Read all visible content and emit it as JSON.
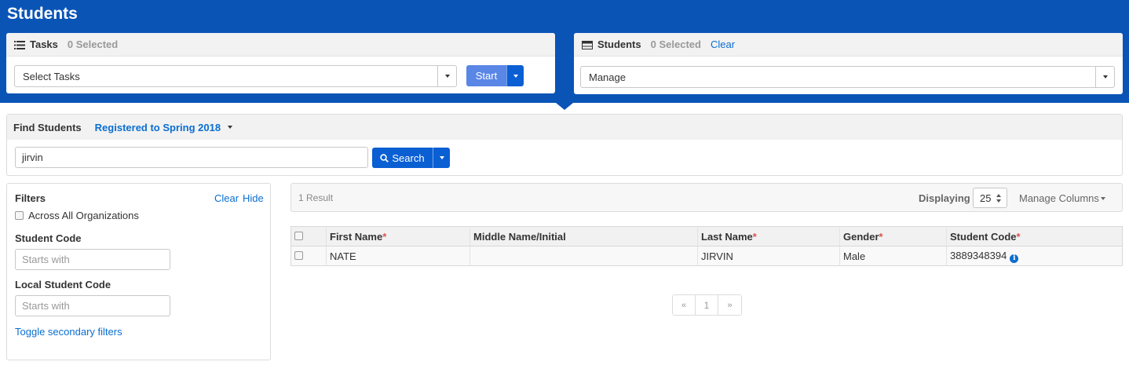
{
  "header": {
    "title": "Students"
  },
  "tasks": {
    "title": "Tasks",
    "selected_count": "0 Selected",
    "select_placeholder": "Select Tasks",
    "start_label": "Start"
  },
  "students_panel": {
    "title": "Students",
    "selected_count": "0 Selected",
    "clear_label": "Clear",
    "manage_value": "Manage"
  },
  "find": {
    "title": "Find Students",
    "filter_link": "Registered to Spring 2018",
    "search_value": "jirvin",
    "search_label": "Search"
  },
  "filters": {
    "title": "Filters",
    "clear_label": "Clear",
    "hide_label": "Hide",
    "across_orgs_label": "Across All Organizations",
    "student_code_label": "Student Code",
    "student_code_placeholder": "Starts with",
    "local_code_label": "Local Student Code",
    "local_code_placeholder": "Starts with",
    "toggle_secondary": "Toggle secondary filters"
  },
  "results": {
    "count_text": "1 Result",
    "displaying_label": "Displaying",
    "per_page": "25",
    "manage_columns": "Manage Columns"
  },
  "table": {
    "columns": [
      {
        "label": "First Name",
        "required": "*"
      },
      {
        "label": "Middle Name/Initial",
        "required": ""
      },
      {
        "label": "Last Name",
        "required": "*"
      },
      {
        "label": "Gender",
        "required": "*"
      },
      {
        "label": "Student Code",
        "required": "*"
      }
    ],
    "rows": [
      {
        "first": "NATE",
        "middle": "",
        "last": "JIRVIN",
        "gender": "Male",
        "code": "3889348394"
      }
    ]
  },
  "pagination": {
    "prev": "«",
    "page": "1",
    "next": "»"
  },
  "colors": {
    "header_blue": "#0a54b6",
    "button_blue": "#0a5fd3",
    "start_button": "#5a86e6",
    "link": "#0a6ed1",
    "required": "#d9534f"
  }
}
